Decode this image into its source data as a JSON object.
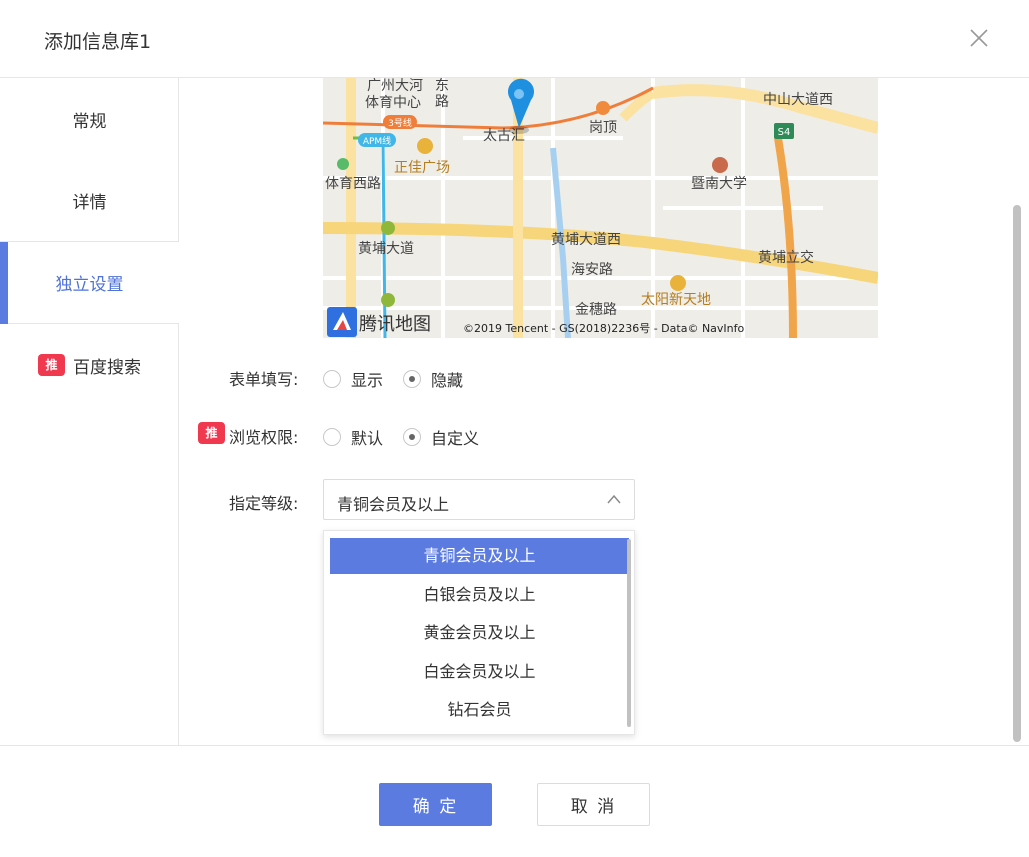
{
  "dialog": {
    "title": "添加信息库1"
  },
  "sidebar": {
    "items": [
      {
        "label": "常规"
      },
      {
        "label": "详情"
      },
      {
        "label": "独立设置"
      },
      {
        "label": "百度搜索",
        "badge": "推"
      }
    ]
  },
  "map": {
    "labels": {
      "a": "广州大河",
      "b": "体育中心",
      "c": "东",
      "d": "路",
      "e": "岗顶",
      "f": "中山大道西",
      "g": "太古汇",
      "h": "正佳广场",
      "i": "体育西路",
      "j": "暨南大学",
      "k": "黄埔大道",
      "l": "黄埔大道西",
      "m": "海安路",
      "n": "黄埔立交",
      "o": "金穗路",
      "p": "太阳新天地",
      "q": "3号线",
      "r": "APM线",
      "s": "S4"
    },
    "logo_text": "腾讯地图",
    "copyright": "©2019 Tencent - GS(2018)2236号 - Data© NavInfo"
  },
  "form": {
    "fill": {
      "label": "表单填写:",
      "options": [
        "显示",
        "隐藏"
      ],
      "selected": "隐藏"
    },
    "permission": {
      "badge": "推",
      "label": "浏览权限:",
      "options": [
        "默认",
        "自定义"
      ],
      "selected": "自定义"
    },
    "level": {
      "label": "指定等级:",
      "value": "青铜会员及以上",
      "options": [
        "青铜会员及以上",
        "白银会员及以上",
        "黄金会员及以上",
        "白金会员及以上",
        "钻石会员"
      ]
    }
  },
  "footer": {
    "confirm": "确 定",
    "cancel": "取 消"
  },
  "colors": {
    "accent": "#5b7be0",
    "badge": "#f0384f"
  }
}
